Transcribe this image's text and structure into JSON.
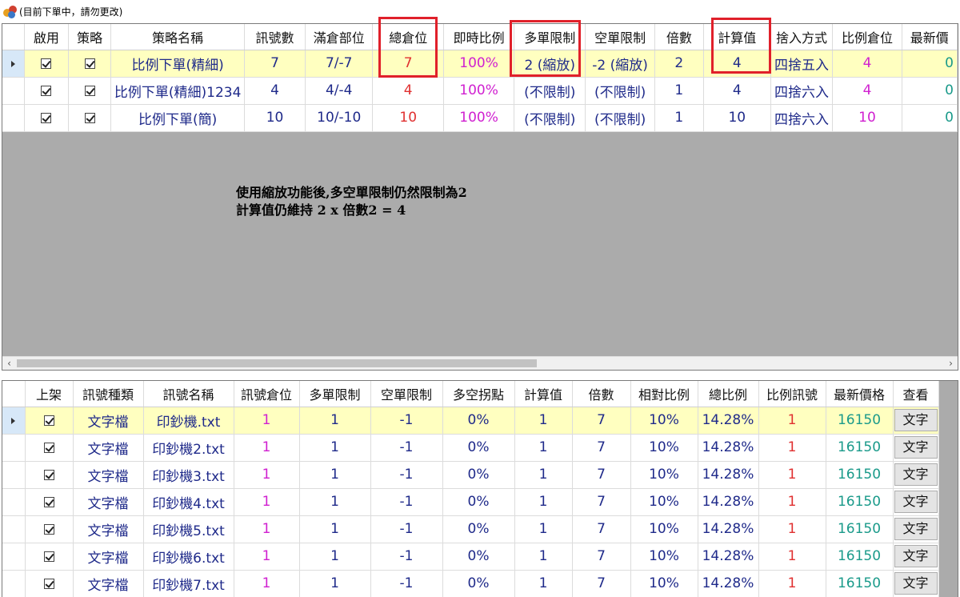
{
  "window": {
    "title": "(目前下單中，請勿更改)"
  },
  "strategy_grid": {
    "headers": [
      "啟用",
      "策略",
      "策略名稱",
      "訊號數",
      "滿倉部位",
      "總倉位",
      "即時比例",
      "多單限制",
      "空單限制",
      "倍數",
      "計算值",
      "捨入方式",
      "比例倉位",
      "最新價"
    ],
    "rows": [
      {
        "name": "比例下單(精細)",
        "signals": "7",
        "full_position": "7/-7",
        "total_position": "7",
        "ratio": "100%",
        "long_limit": "2 (縮放)",
        "short_limit": "-2 (縮放)",
        "multiplier": "2",
        "calc_value": "4",
        "rounding": "四捨五入",
        "ratio_position": "4",
        "latest": "0"
      },
      {
        "name": "比例下單(精細)1234",
        "signals": "4",
        "full_position": "4/-4",
        "total_position": "4",
        "ratio": "100%",
        "long_limit": "(不限制)",
        "short_limit": "(不限制)",
        "multiplier": "1",
        "calc_value": "4",
        "rounding": "四捨六入",
        "ratio_position": "4",
        "latest": "0"
      },
      {
        "name": "比例下單(簡)",
        "signals": "10",
        "full_position": "10/-10",
        "total_position": "10",
        "ratio": "100%",
        "long_limit": "(不限制)",
        "short_limit": "(不限制)",
        "multiplier": "1",
        "calc_value": "10",
        "rounding": "四捨六入",
        "ratio_position": "10",
        "latest": "0"
      }
    ]
  },
  "annotation": {
    "line1": "使用縮放功能後,多空單限制仍然限制為2",
    "line2": "計算值仍維持 2 x 倍數2 = 4"
  },
  "signal_grid": {
    "headers": [
      "上架",
      "訊號種類",
      "訊號名稱",
      "訊號倉位",
      "多單限制",
      "空單限制",
      "多空拐點",
      "計算值",
      "倍數",
      "相對比例",
      "總比例",
      "比例訊號",
      "最新價格",
      "查看"
    ],
    "view_button_label": "文字",
    "rows": [
      {
        "type": "文字檔",
        "name": "印鈔機.txt",
        "position": "1",
        "long_limit": "1",
        "short_limit": "-1",
        "pivot": "0%",
        "calc_value": "1",
        "multiplier": "7",
        "rel_ratio": "10%",
        "total_ratio": "14.28%",
        "ratio_signal": "1",
        "latest_price": "16150"
      },
      {
        "type": "文字檔",
        "name": "印鈔機2.txt",
        "position": "1",
        "long_limit": "1",
        "short_limit": "-1",
        "pivot": "0%",
        "calc_value": "1",
        "multiplier": "7",
        "rel_ratio": "10%",
        "total_ratio": "14.28%",
        "ratio_signal": "1",
        "latest_price": "16150"
      },
      {
        "type": "文字檔",
        "name": "印鈔機3.txt",
        "position": "1",
        "long_limit": "1",
        "short_limit": "-1",
        "pivot": "0%",
        "calc_value": "1",
        "multiplier": "7",
        "rel_ratio": "10%",
        "total_ratio": "14.28%",
        "ratio_signal": "1",
        "latest_price": "16150"
      },
      {
        "type": "文字檔",
        "name": "印鈔機4.txt",
        "position": "1",
        "long_limit": "1",
        "short_limit": "-1",
        "pivot": "0%",
        "calc_value": "1",
        "multiplier": "7",
        "rel_ratio": "10%",
        "total_ratio": "14.28%",
        "ratio_signal": "1",
        "latest_price": "16150"
      },
      {
        "type": "文字檔",
        "name": "印鈔機5.txt",
        "position": "1",
        "long_limit": "1",
        "short_limit": "-1",
        "pivot": "0%",
        "calc_value": "1",
        "multiplier": "7",
        "rel_ratio": "10%",
        "total_ratio": "14.28%",
        "ratio_signal": "1",
        "latest_price": "16150"
      },
      {
        "type": "文字檔",
        "name": "印鈔機6.txt",
        "position": "1",
        "long_limit": "1",
        "short_limit": "-1",
        "pivot": "0%",
        "calc_value": "1",
        "multiplier": "7",
        "rel_ratio": "10%",
        "total_ratio": "14.28%",
        "ratio_signal": "1",
        "latest_price": "16150"
      },
      {
        "type": "文字檔",
        "name": "印鈔機7.txt",
        "position": "1",
        "long_limit": "1",
        "short_limit": "-1",
        "pivot": "0%",
        "calc_value": "1",
        "multiplier": "7",
        "rel_ratio": "10%",
        "total_ratio": "14.28%",
        "ratio_signal": "1",
        "latest_price": "16150"
      }
    ]
  },
  "colors": {
    "highlight": "#e0202a",
    "selected_row": "#ffffc0",
    "empty_grid_area": "#ababab"
  },
  "icons": {
    "app": "app-logo-icon",
    "row_indicator": "row-pointer-icon",
    "checkbox": "checked-checkbox-icon",
    "scroll_left": "chevron-left-icon",
    "scroll_right": "chevron-right-icon"
  }
}
